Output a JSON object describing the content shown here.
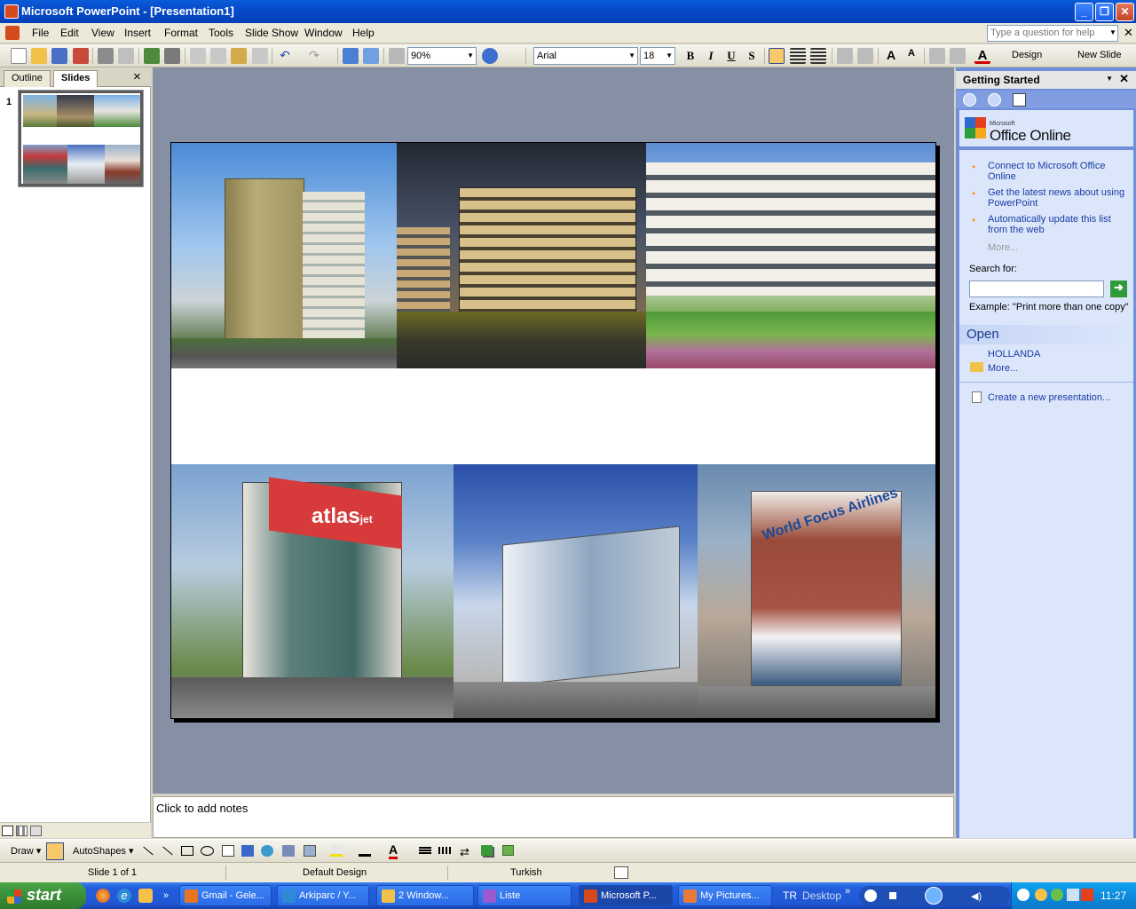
{
  "window": {
    "title": "Microsoft PowerPoint - [Presentation1]"
  },
  "menu": {
    "items": [
      "File",
      "Edit",
      "View",
      "Insert",
      "Format",
      "Tools",
      "Slide Show",
      "Window",
      "Help"
    ],
    "help_placeholder": "Type a question for help"
  },
  "toolbar": {
    "zoom": "90%",
    "font_name": "Arial",
    "font_size": "18",
    "bold": "B",
    "italic": "I",
    "underline": "U",
    "shadow": "S",
    "design_label": "Design",
    "new_slide_label": "New Slide"
  },
  "left_pane": {
    "tabs": [
      "Outline",
      "Slides"
    ],
    "active_tab": "Slides",
    "slide_number": "1",
    "close_glyph": "×"
  },
  "notes": {
    "placeholder": "Click to add notes"
  },
  "task_pane": {
    "title": "Getting Started",
    "brand_small": "Microsoft",
    "brand": "Office Online",
    "links": [
      "Connect to Microsoft Office Online",
      "Get the latest news about using PowerPoint",
      "Automatically update this list from the web"
    ],
    "more1": "More...",
    "search_label": "Search for:",
    "example": "Example:  \"Print more than one copy\"",
    "open_header": "Open",
    "open_items": [
      "HOLLANDA"
    ],
    "more2": "More...",
    "create_new": "Create a new presentation..."
  },
  "draw_toolbar": {
    "draw_label": "Draw",
    "autoshapes_label": "AutoShapes"
  },
  "status": {
    "slide": "Slide 1 of 1",
    "design": "Default Design",
    "language": "Turkish"
  },
  "taskbar": {
    "start": "start",
    "tasks": [
      "Gmail - Gele...",
      "Arkiparc / Y...",
      "2 Window...",
      "Liste",
      "Microsoft P...",
      "My Pictures..."
    ],
    "lang": "TR",
    "desktop": "Desktop",
    "clock": "11:27"
  },
  "slide_images": {
    "top_left": "residential tower",
    "top_middle": "office block at dusk",
    "top_right": "apartment complex with gardens",
    "bottom_left": "atlas building",
    "bottom_middle": "modern commercial building",
    "bottom_right": "World Focus Airlines building"
  },
  "sign_texts": {
    "atlas": "atlas",
    "atlas_suffix": "jet",
    "world_focus": "World Focus Airlines"
  },
  "colors": {
    "accent": "#0a5cdb",
    "taskpane": "#6f8fd9",
    "slide_bg": "#8690a5"
  }
}
